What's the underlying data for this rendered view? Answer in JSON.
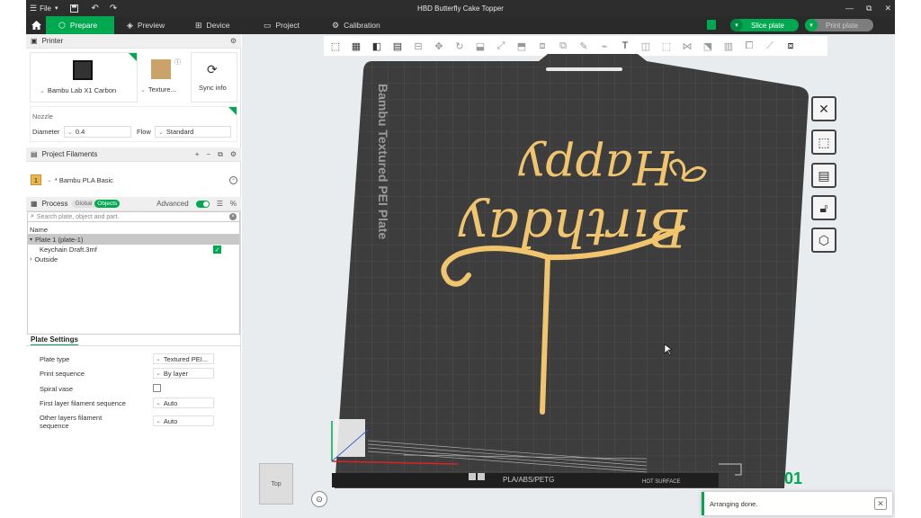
{
  "titlebar": {
    "menu_label": "File",
    "title": "HBD Butterfly Cake Topper",
    "controls": [
      "—",
      "⧉",
      "✕"
    ]
  },
  "toolbar": {
    "tabs": [
      {
        "label": "Prepare",
        "icon": "prepare-icon"
      },
      {
        "label": "Preview",
        "icon": "preview-icon"
      },
      {
        "label": "Device",
        "icon": "device-icon"
      },
      {
        "label": "Project",
        "icon": "project-icon"
      },
      {
        "label": "Calibration",
        "icon": "calibration-icon"
      }
    ],
    "slice_label": "Slice plate",
    "print_label": "Print plate"
  },
  "printer": {
    "header": "Printer",
    "printer_name": "Bambu Lab X1 Carbon",
    "plate_name": "Texture...",
    "sync_label": "Sync info",
    "nozzle_label": "Nozzle",
    "diameter_label": "Diameter",
    "diameter_value": "0.4",
    "flow_label": "Flow",
    "flow_value": "Standard"
  },
  "filaments": {
    "header": "Project Filaments",
    "items": [
      {
        "index": "1",
        "name": "* Bambu PLA Basic",
        "color": "#e8b84a"
      }
    ]
  },
  "process": {
    "header": "Process",
    "toggle_global": "Global",
    "toggle_objects": "Objects",
    "advanced_label": "Advanced",
    "search_placeholder": "Search plate, object and part.",
    "column_name": "Name",
    "rows": [
      "Plate 1 (plate-1)",
      "Keychain Draft.3mf",
      "Outside"
    ]
  },
  "plate_settings": {
    "header": "Plate Settings",
    "rows": [
      {
        "label": "Plate type",
        "value": "Textured PEI..."
      },
      {
        "label": "Print sequence",
        "value": "By layer"
      },
      {
        "label": "Spiral vase",
        "value": ""
      },
      {
        "label": "First layer filament sequence",
        "value": "Auto"
      },
      {
        "label": "Other layers filament sequence",
        "value": "Auto"
      }
    ]
  },
  "viewport": {
    "plate_label": "Bambu Textured PEI Plate",
    "plate_number": "01",
    "bottom_strip_text": "PLA/ABS/PETG",
    "hot_surface": "HOT SURFACE",
    "view_cube_label": "Top",
    "notification": "Arranging done.",
    "model_text_line1": "Happy",
    "model_text_line2": "Birthday"
  },
  "colors": {
    "accent": "#00a84f",
    "bed": "#3a3a3a",
    "model": "#f0c56e",
    "titlebar": "#2d2d2d"
  }
}
